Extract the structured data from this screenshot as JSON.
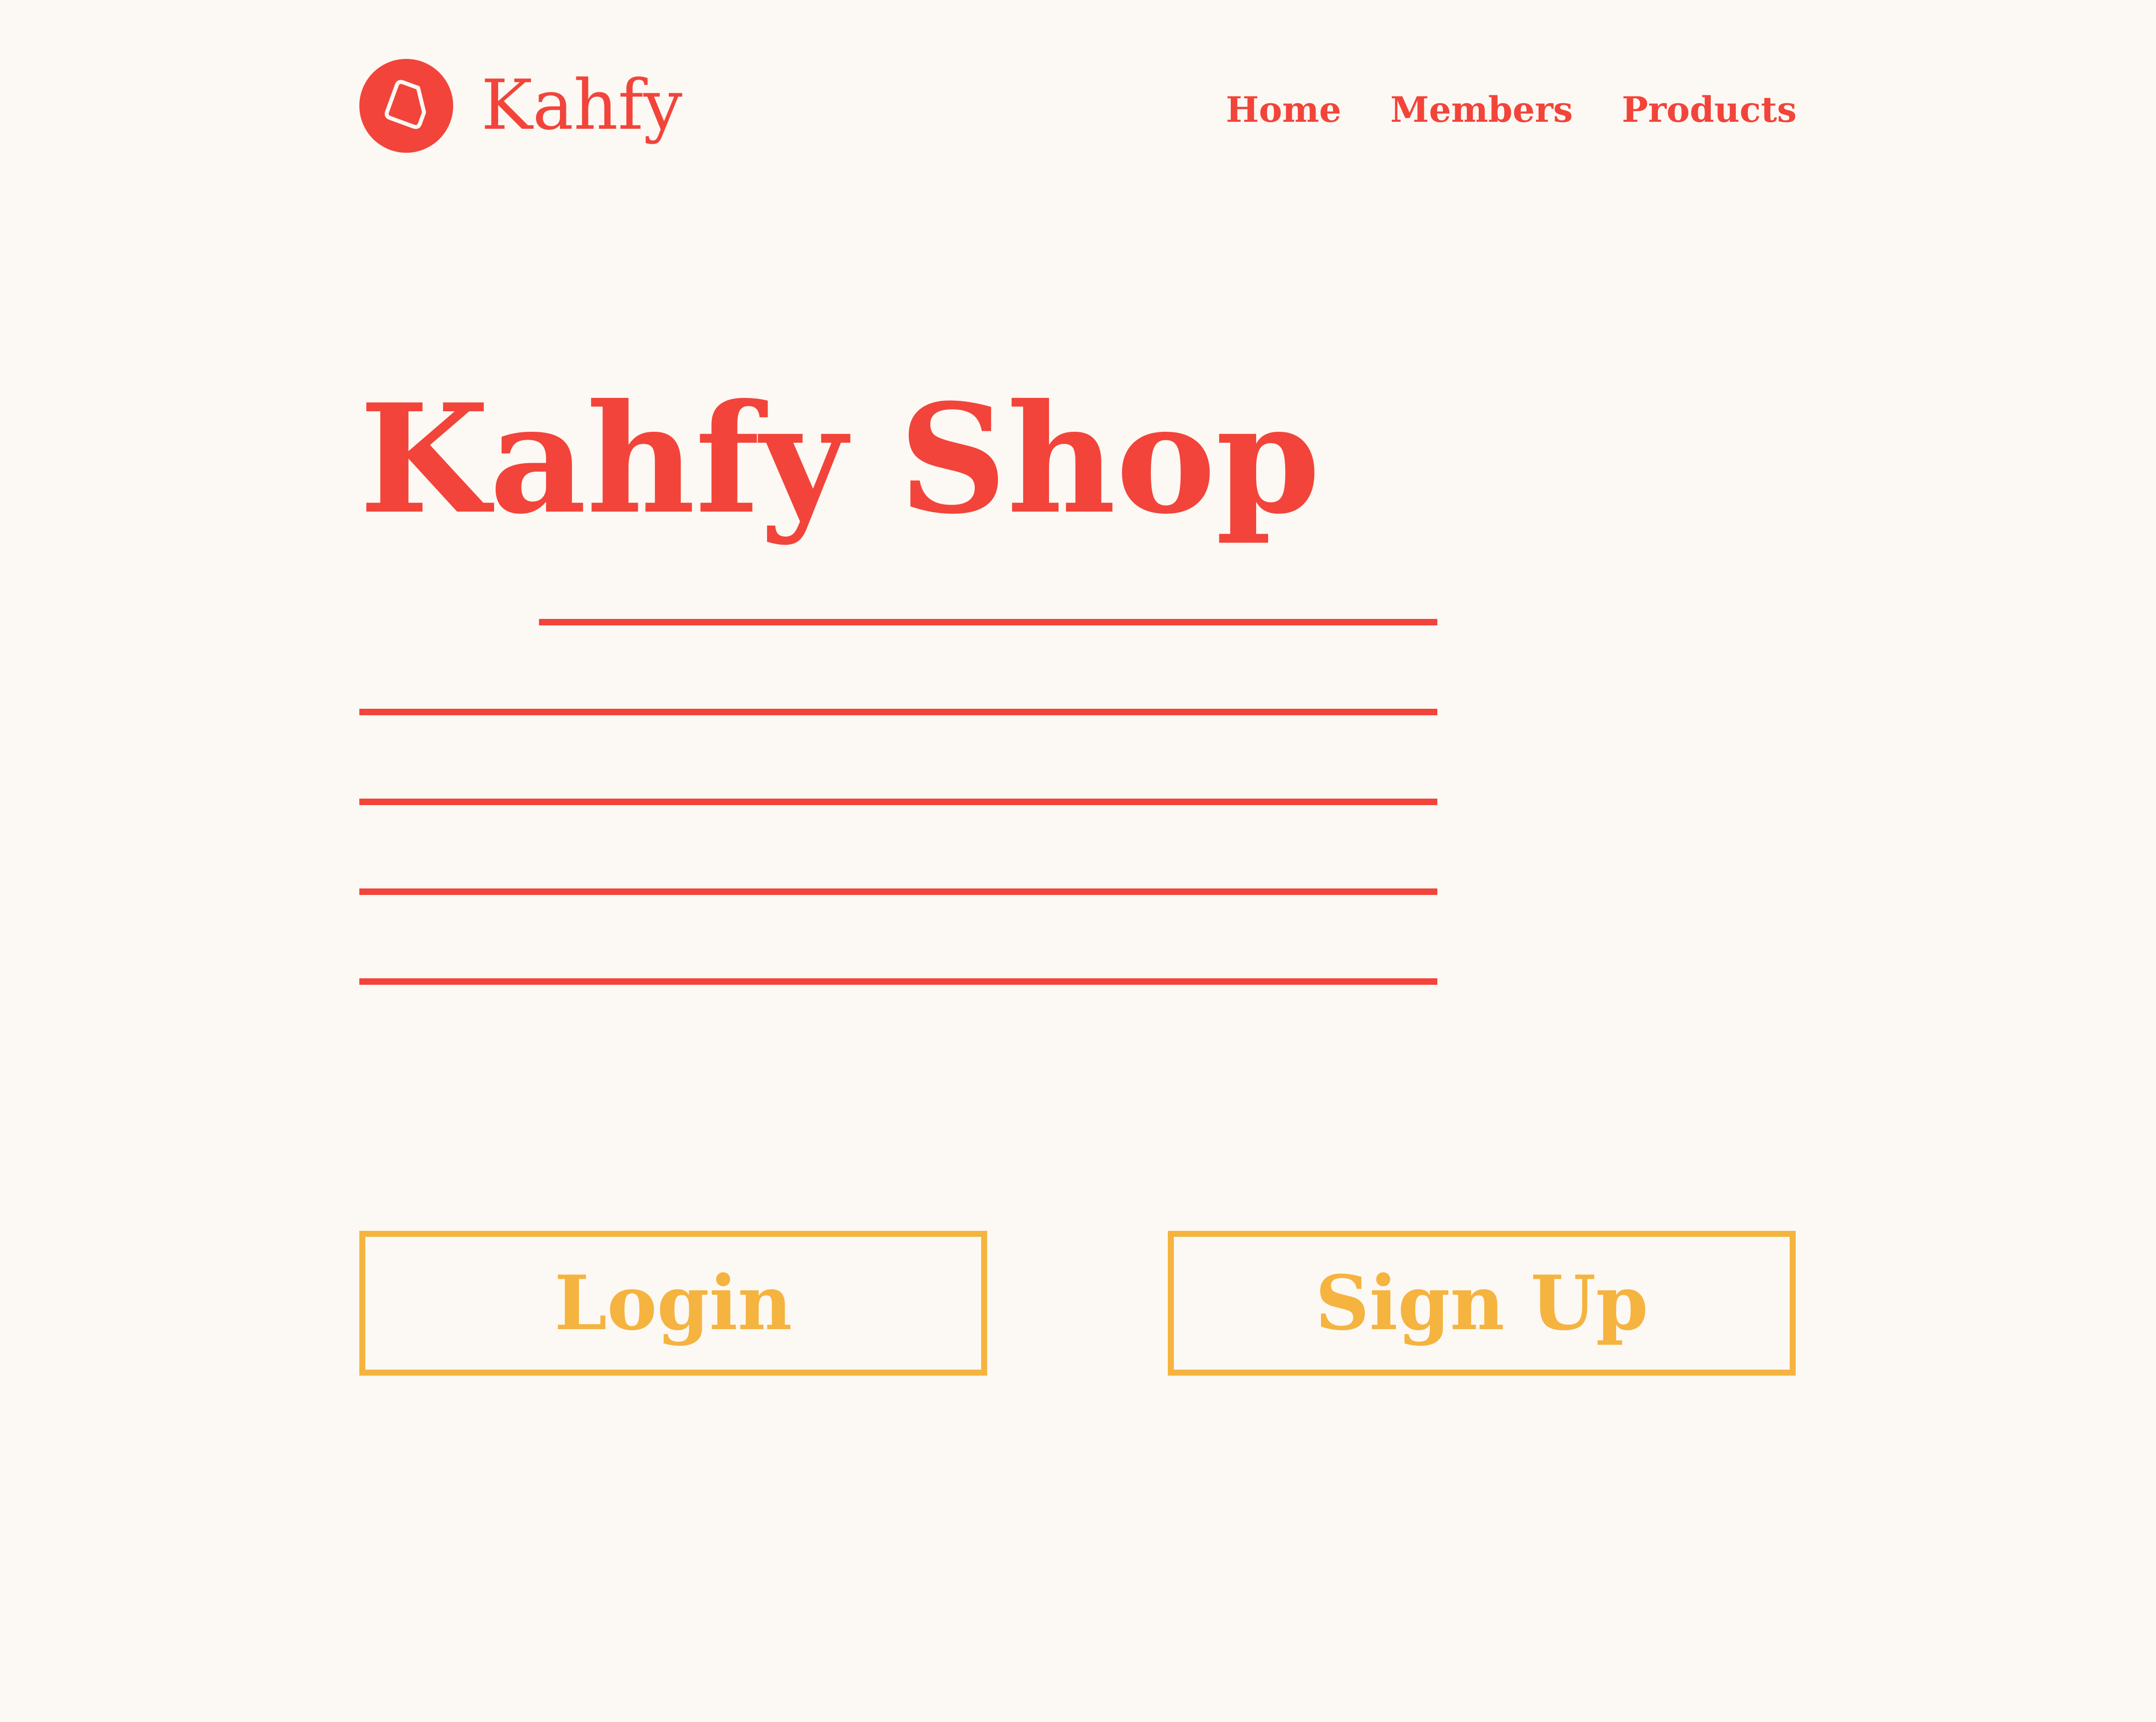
{
  "header": {
    "brand": "Kahfy",
    "logo_icon": "tag-icon",
    "nav": [
      "Home",
      "Members",
      "Products"
    ]
  },
  "hero": {
    "title": "Kahfy Shop",
    "text_line_count": 5
  },
  "actions": {
    "login_label": "Login",
    "signup_label": "Sign Up"
  },
  "colors": {
    "background": "#fcf8f3",
    "primary": "#f2443a",
    "accent": "#f5b33f"
  }
}
